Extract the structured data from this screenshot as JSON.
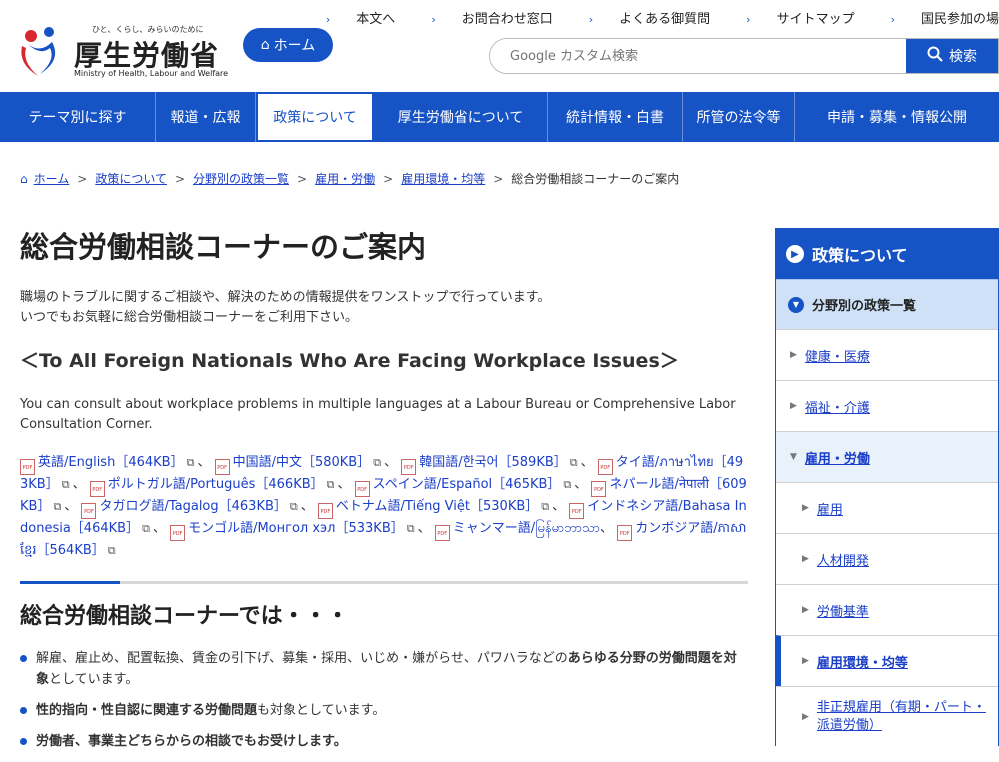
{
  "header": {
    "tagline": "ひと、くらし、みらいのために",
    "title": "厚生労働省",
    "title_en": "Ministry of Health, Labour and Welfare",
    "home_label": "ホーム",
    "utility": [
      "本文へ",
      "お問合わせ窓口",
      "よくある御質問",
      "サイトマップ",
      "国民参加の場"
    ],
    "search_placeholder": "Google カスタム検索",
    "search_button": "検索"
  },
  "gnav": [
    "テーマ別に探す",
    "報道・広報",
    "政策について",
    "厚生労働省について",
    "統計情報・白書",
    "所管の法令等",
    "申請・募集・情報公開"
  ],
  "breadcrumb": [
    "ホーム",
    "政策について",
    "分野別の政策一覧",
    "雇用・労働",
    "雇用環境・均等",
    "総合労働相談コーナーのご案内"
  ],
  "main": {
    "title": "総合労働相談コーナーのご案内",
    "intro_1": "職場のトラブルに関するご相談や、解決のための情報提供をワンストップで行っています。",
    "intro_2": "いつでもお気軽に総合労働相談コーナーをご利用下さい。",
    "subheading": "＜To All Foreign Nationals Who Are Facing Workplace Issues＞",
    "en_text": "You can consult about workplace problems in multiple languages at a Labour Bureau or Comprehensive Labor Consultation Corner.",
    "languages": [
      "英語/English［464KB］",
      "中国語/中文［580KB］",
      "韓国語/한국어［589KB］",
      "タイ語/ภาษาไทย［493KB］",
      "ポルトガル語/Português［466KB］",
      "スペイン語/Español［465KB］",
      "ネパール語/नेपाली［609KB］",
      "タガログ語/Tagalog［463KB］",
      "ベトナム語/Tiếng Việt［530KB］",
      "インドネシア語/Bahasa Indonesia［464KB］",
      "モンゴル語/Монгол хэл［533KB］",
      "ミャンマー語/မြန်မာဘာသာ",
      "カンボジア語/ភាសាខ្មែរ［564KB］"
    ],
    "section_title": "総合労働相談コーナーでは・・・",
    "bullet_1_a": "解雇、雇止め、配置転換、賃金の引下げ、募集・採用、いじめ・嫌がらせ、パワハラなどの",
    "bullet_1_b": "あらゆる分野の労働問題を対象",
    "bullet_1_c": "としています。",
    "bullet_2_a": "性的指向・性自認に関連する労働問題",
    "bullet_2_b": "も対象としています。",
    "bullet_3": "労働者、事業主どちらからの相談でもお受けします。"
  },
  "sidebar": {
    "head": "政策について",
    "sub": "分野別の政策一覧",
    "items": [
      "健康・医療",
      "福祉・介護",
      "雇用・労働",
      "雇用",
      "人材開発",
      "労働基準",
      "雇用環境・均等",
      "非正規雇用（有期・パート・派遣労働）"
    ]
  },
  "colors": {
    "brand": "#1653c4",
    "link": "#1a3ec8",
    "sidebar_sub_bg": "#cfe1f7"
  }
}
